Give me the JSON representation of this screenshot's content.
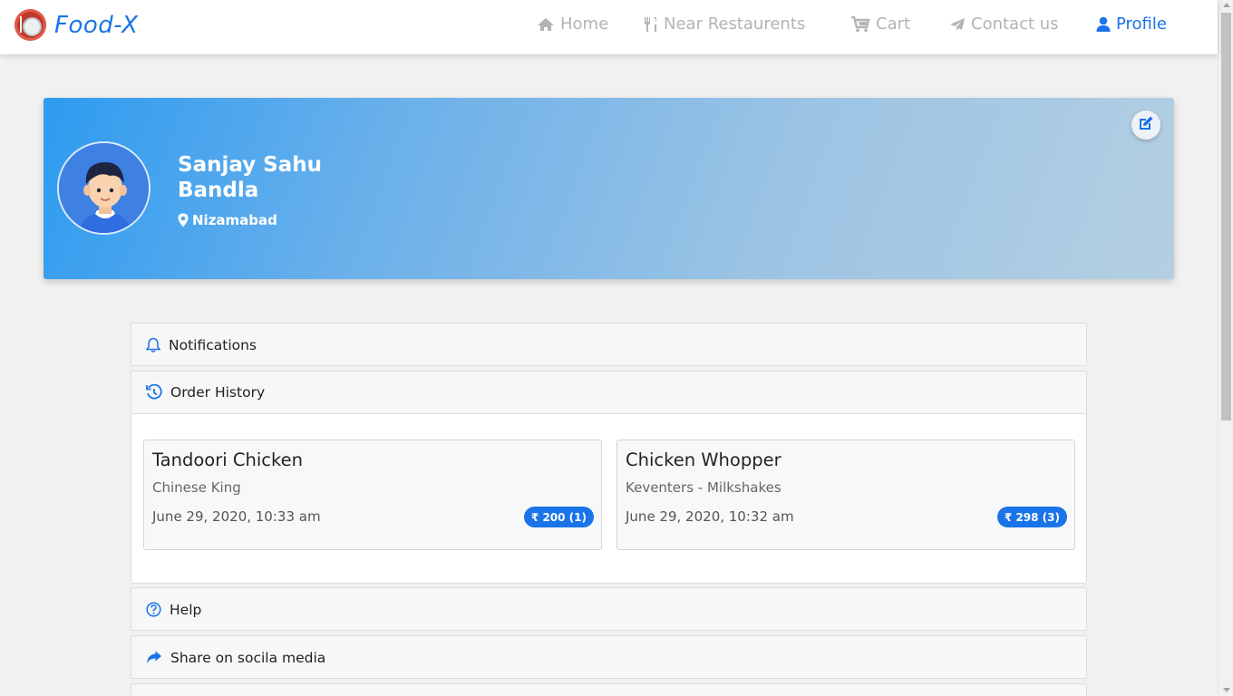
{
  "brand": {
    "name": "Food-X"
  },
  "nav": {
    "home": "Home",
    "near": "Near Restaurents",
    "cart": "Cart",
    "contact": "Contact us",
    "profile": "Profile"
  },
  "profile": {
    "name": "Sanjay Sahu Bandla",
    "location": "Nizamabad"
  },
  "sections": {
    "notifications": "Notifications",
    "order_history": "Order History",
    "help": "Help",
    "share": "Share on socila media"
  },
  "orders": [
    {
      "item": "Tandoori Chicken",
      "restaurant": "Chinese King",
      "date": "June 29, 2020, 10:33 am",
      "price_label": "₹ 200 (1)"
    },
    {
      "item": "Chicken Whopper",
      "restaurant": "Keventers - Milkshakes",
      "date": "June 29, 2020, 10:32 am",
      "price_label": "₹ 298 (3)"
    }
  ],
  "colors": {
    "accent": "#1a73e8",
    "nav_inactive": "#b3b3b3",
    "banner_start": "#2d9bf0",
    "banner_end": "#b4cfe2"
  },
  "icons": {
    "home": "home-icon",
    "near": "cutlery-icon",
    "cart": "cart-icon",
    "contact": "paper-plane-icon",
    "profile": "user-icon",
    "location": "map-marker-icon",
    "edit": "edit-icon",
    "notifications": "bell-icon",
    "history": "history-icon",
    "help": "question-circle-icon",
    "share": "share-icon"
  }
}
